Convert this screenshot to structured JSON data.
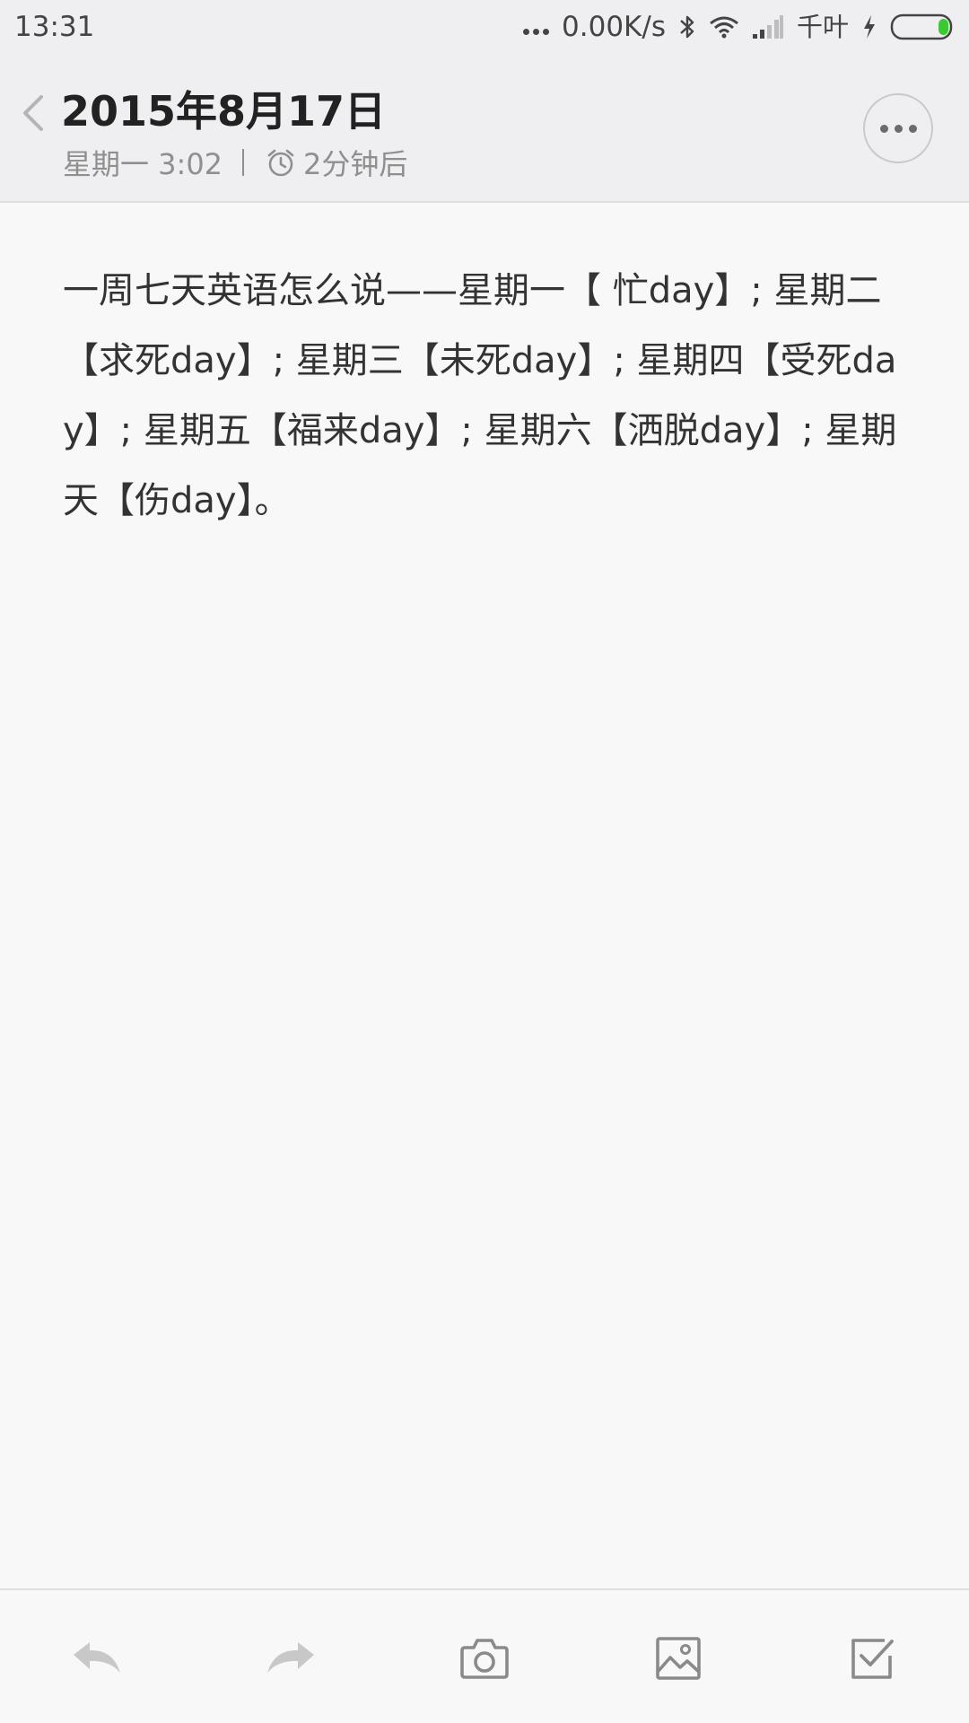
{
  "status_bar": {
    "time": "13:31",
    "net_speed": "0.00K/s",
    "carrier": "千叶",
    "icons": [
      "more-dots-icon",
      "bluetooth-icon",
      "wifi-icon",
      "signal-icon",
      "charging-icon",
      "battery-icon"
    ],
    "battery_color": "#3cc832"
  },
  "header": {
    "title": "2015年8月17日",
    "weekday_time": "星期一 3:02",
    "reminder": "2分钟后",
    "icons": [
      "back-chevron-icon",
      "alarm-clock-icon",
      "more-dots-icon"
    ]
  },
  "note": {
    "content": "一周七天英语怎么说——星期一【 忙day】; 星期二【求死day】; 星期三【未死day】; 星期四【受死day】; 星期五【福来day】; 星期六【洒脱day】; 星期天【伤day】。"
  },
  "toolbar": {
    "icons": [
      "undo-icon",
      "redo-icon",
      "camera-icon",
      "image-icon",
      "checklist-icon"
    ]
  }
}
